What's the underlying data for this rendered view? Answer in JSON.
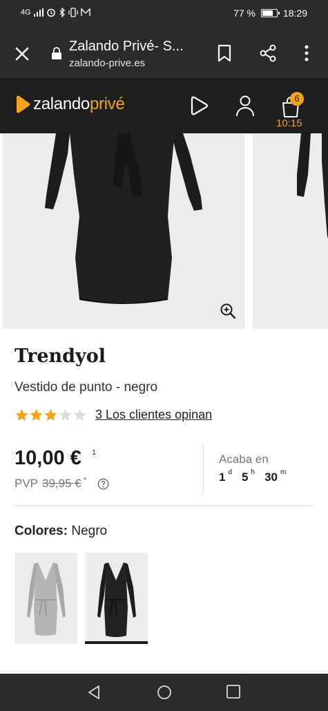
{
  "status_bar": {
    "network": "4G",
    "battery_text": "77 %",
    "battery_level": 0.77,
    "time": "18:29"
  },
  "browser": {
    "title": "Zalando Privé- S...",
    "url": "zalando-prive.es",
    "icons": [
      "close-icon",
      "lock-icon",
      "bookmark-icon",
      "share-icon",
      "menu-icon"
    ]
  },
  "header": {
    "logo_main": "zalando",
    "logo_accent": "privé",
    "cart_count": "6",
    "cart_timer": "10:15",
    "accent_color": "#f7a21b"
  },
  "product": {
    "brand": "Trendyol",
    "name": "Vestido de punto - negro",
    "rating": 3,
    "rating_max": 5,
    "reviews_link": "3 Los clientes opinan",
    "price": "10,00 €",
    "price_note": "1",
    "pvp_label": "PVP",
    "pvp_old": "39,95 €",
    "pvp_mark": "*"
  },
  "countdown": {
    "label": "Acaba en",
    "days": "1",
    "days_unit": "d",
    "hours": "5",
    "hours_unit": "h",
    "minutes": "30",
    "minutes_unit": "m"
  },
  "colors": {
    "label": "Colores:",
    "selected": "Negro",
    "swatches": [
      "grey",
      "black"
    ]
  }
}
